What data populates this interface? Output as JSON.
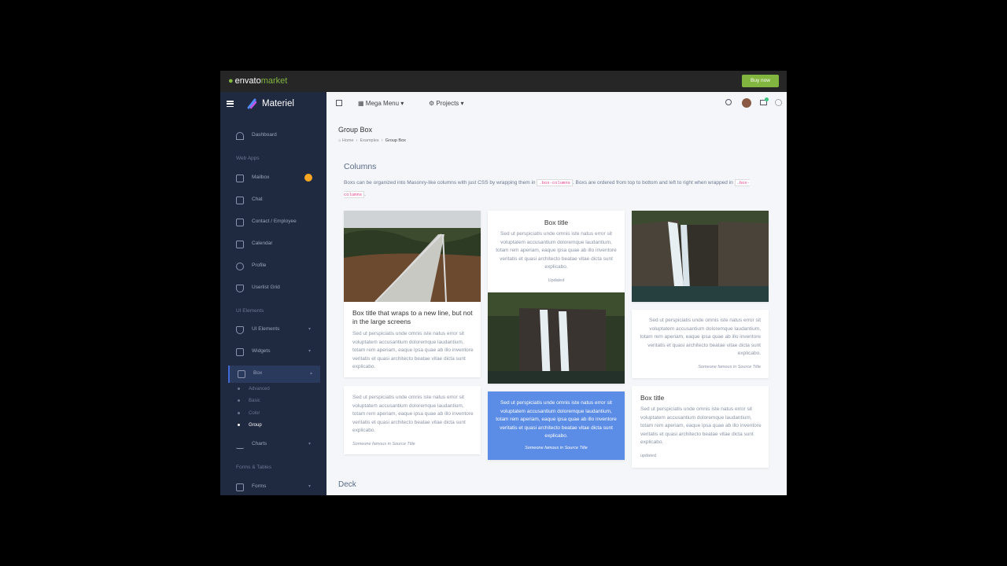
{
  "envato": {
    "logo_word": "envato",
    "logo_market": "market",
    "buy_label": "Buy now"
  },
  "brand": {
    "name": "Materiel"
  },
  "sidebar": {
    "dashboard": "Dashboard",
    "section_webapps": "Web Apps",
    "mailbox": "Mailbox",
    "mailbox_badge": "",
    "chat": "Chat",
    "contact": "Contact / Employee",
    "calendar": "Calendar",
    "profile": "Profile",
    "userlist": "Userlist Grid",
    "section_ui": "UI Elements",
    "ui_elements": "UI Elements",
    "widgets": "Widgets",
    "box": "Box",
    "sub": [
      "Advanced",
      "Basic",
      "Color",
      "Group"
    ],
    "charts": "Charts",
    "section_forms": "Forms & Tables",
    "forms": "Forms"
  },
  "topnav": {
    "mega_menu": "Mega Menu",
    "projects": "Projects"
  },
  "page": {
    "title": "Group Box",
    "crumbs": [
      "Home",
      "Examples",
      "Group Box"
    ],
    "section": "Columns",
    "desc_1": "Boxs can be organized into Masonry-like columns with just CSS by wrapping them in",
    "code_1": ".box-columns",
    "desc_2": ". Boxs are ordered from top to bottom and left to right when wrapped in",
    "code_2": ".box-columns",
    "desc_3": ".",
    "deck": "Deck"
  },
  "cards": {
    "c1_title": "Box title that wraps to a new line, but not in the large screens",
    "lorem": "Sed ut perspiciatis unde omnis iste natus error sit voluptatem accusantium doloremque laudantium, totam rem aperiam, eaque ipsa quae ab illo inventore veritatis et quasi architecto beatae vitae dicta sunt explicabo.",
    "c2_title": "Box title",
    "c2_foot": "Updated",
    "quote_foot": "Someone famous in Source Title",
    "c6_title": "Box title",
    "c6_foot": "updated"
  },
  "colors": {
    "accent": "#3f6ad8",
    "highlight_card": "#5b8ce6",
    "sidebar_bg": "#1f2940",
    "envato_green": "#82b440"
  }
}
